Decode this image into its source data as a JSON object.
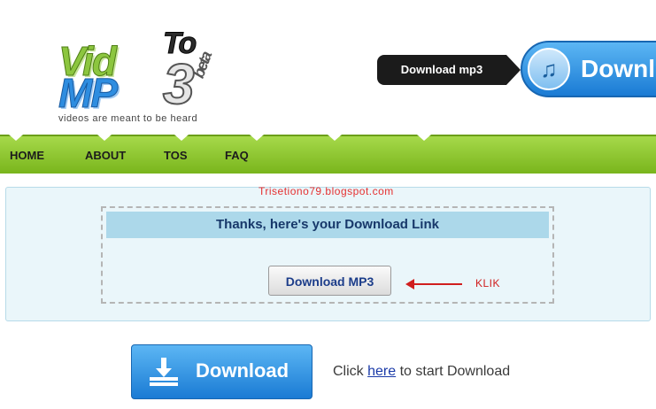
{
  "logo": {
    "vid": "Vid",
    "to": "To",
    "mp": "MP",
    "three": "3",
    "beta": "beta",
    "tagline": "videos are meant to be heard"
  },
  "header": {
    "dl_mp3_label": "Download mp3",
    "download_label": "Downlo",
    "music_icon": "music-note-icon"
  },
  "nav": {
    "items": [
      "HOME",
      "ABOUT",
      "TOS",
      "FAQ"
    ]
  },
  "panel": {
    "watermark": "Trisetiono79.blogspot.com",
    "thanks": "Thanks, here's your Download Link",
    "download_mp3": "Download MP3",
    "klik": "KLIK"
  },
  "bottom": {
    "download_label": "Download",
    "click_prefix": "Click",
    "here_link": "here",
    "click_suffix": "to start Download"
  },
  "colors": {
    "nav_green": "#8cc63f",
    "button_blue": "#2e8de0",
    "annotation_red": "#d01e1e"
  }
}
